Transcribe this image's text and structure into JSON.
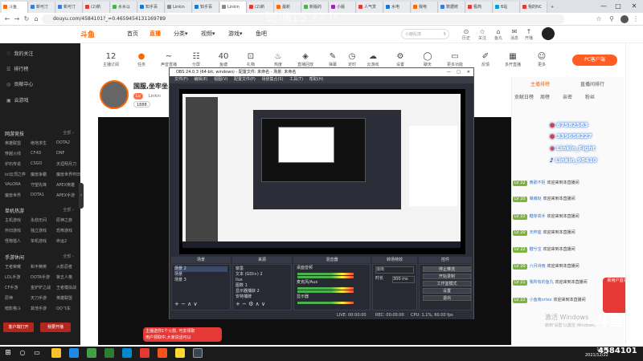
{
  "browser": {
    "tabs": [
      "斗鱼",
      "新可汀",
      "新可汀",
      "(2)新",
      "水水以",
      "知乎百",
      "Linkin",
      "知乎百",
      "Linkin",
      "(2)新",
      "最新",
      "新版的",
      "小版",
      "人气赏",
      "水电",
      "我电",
      "数据统",
      "极简",
      "B站",
      "我的NC",
      "+"
    ],
    "url": "douyu.com/4584101?_=0.4659454131169789",
    "win_controls": [
      "—",
      "□",
      "✕"
    ]
  },
  "header": {
    "logo": "斗鱼",
    "nav": [
      "首页",
      "直播",
      "分类▾",
      "视频▾",
      "游戏▾",
      "鱼吧"
    ],
    "search_placeholder": "小鹿乱撞",
    "icons": [
      {
        "icon": "⊙",
        "label": "历史"
      },
      {
        "icon": "☆",
        "label": "关注"
      },
      {
        "icon": "⌂",
        "label": "鱼丸"
      },
      {
        "icon": "✉",
        "label": "消息"
      },
      {
        "icon": "↑",
        "label": "开播"
      }
    ]
  },
  "sidebar": {
    "top": [
      {
        "icon": "♡",
        "label": "我的关注"
      },
      {
        "icon": "☰",
        "label": "排行榜"
      },
      {
        "icon": "◎",
        "label": "贡献中心"
      },
      {
        "icon": "▣",
        "label": "云游戏"
      }
    ],
    "sections": [
      {
        "title": "网游竞技",
        "more": "全部 ›",
        "cells": [
          "英雄联盟",
          "绝地求生",
          "DOTA2",
          "穿越火线",
          "CF4D",
          "DNF",
          "炉石传说",
          "CSGO",
          "天涯明月刀",
          "lol云顶之弈",
          "魔兽争霸",
          "魔兽世界怀旧",
          "VALORA",
          "守望先锋",
          "APEX英雄",
          "魔兽世界",
          "DOTA1",
          "APEX手游"
        ]
      },
      {
        "title": "单机热游",
        "more": "全部 ›",
        "cells": [
          "主机游戏",
          "永劫无间",
          "原神之旅",
          "怀旧游戏",
          "独立游戏",
          "恐怖游戏",
          "怪物猎人",
          "单机游戏",
          "命运2"
        ]
      },
      {
        "title": "手游休闲",
        "more": "全部 ›",
        "cells": [
          "王者荣耀",
          "和平精英",
          "火影忍者",
          "LOL手游",
          "DOTA手游",
          "第五人格",
          "CF手游",
          "金铲铲之战",
          "王者模拟战",
          "原神",
          "天刀手游",
          "英雄联盟",
          "暗影格斗",
          "其他手游",
          "QQ飞车"
        ]
      }
    ],
    "buttons": [
      "客户端打开",
      "我要开播"
    ]
  },
  "categories": [
    {
      "icon": "12",
      "label": "主播订阅"
    },
    {
      "icon": "●",
      "label": "任务"
    },
    {
      "icon": "~",
      "label": "声音直播"
    },
    {
      "icon": "☷",
      "label": "分屏"
    },
    {
      "icon": "40",
      "label": "鱼塘"
    },
    {
      "icon": "⊡",
      "label": "礼物"
    },
    {
      "icon": "♨",
      "label": "热度"
    },
    {
      "icon": "◈",
      "label": "直播回放"
    },
    {
      "icon": "✎",
      "label": "弹幕"
    },
    {
      "icon": "◷",
      "label": "定时"
    },
    {
      "icon": "☁",
      "label": "云游戏"
    },
    {
      "icon": "⚙",
      "label": "设置"
    },
    {
      "icon": "◯",
      "label": "聊天"
    },
    {
      "icon": "▭",
      "label": "更多功能"
    },
    {
      "icon": "✐",
      "label": "反馈"
    },
    {
      "icon": "▦",
      "label": "多开直播"
    },
    {
      "icon": "☺",
      "label": "更多"
    }
  ],
  "pc_button": "PC客户端",
  "room": {
    "title": "国服,坐牢坐...",
    "tags": [
      "Lv",
      "Linkin",
      "1888"
    ]
  },
  "watermark": "斑斓15 ?? ir",
  "obs": {
    "title": "OBS 24.0.3 (64-bit, windows) - 配置文件: 未命名 - 场景: 未命名",
    "menu": [
      "文件(F)",
      "编辑(E)",
      "视图(V)",
      "配置文件(P)",
      "场景集合(S)",
      "工具(T)",
      "帮助(H)"
    ],
    "docks": [
      "场景",
      "来源",
      "混音器",
      "转场特效",
      "控件"
    ],
    "scenes": [
      "场景 2",
      "场景",
      "场景 3"
    ],
    "sources": [
      "窗墨",
      "文本 (GDI+) 2",
      "ilus",
      "图数 1",
      "显示器捕获 2",
      "安特捕牌"
    ],
    "mixer": [
      "桌面音频",
      "麦克风/Aux",
      "显示器"
    ],
    "transition": [
      "淡出",
      "时长",
      "300 ms"
    ],
    "controls": [
      "停止推流",
      "开始录制",
      "工作室模式",
      "设置",
      "退出"
    ],
    "status": [
      "LIVE: 00:00:00",
      "REC: 00:00:00",
      "CPU: 1.1%, 60.00 fps"
    ]
  },
  "right_panel": {
    "tabs": [
      "主播排榜",
      "直播间排行",
      "贡献日榜",
      "周榜",
      "亲密",
      "粉丝"
    ],
    "qq_lines": [
      "67582583",
      "339658227",
      "Linkin_Fight",
      "Linkin_98410"
    ],
    "chats": [
      {
        "lv": "LV 22",
        "name": "黄鹂不拒",
        "msg": "欢迎来到本直播间"
      },
      {
        "lv": "LV 20",
        "name": "萌萌哒",
        "msg": "欢迎来到本直播间"
      },
      {
        "lv": "LV 22",
        "name": "糖芽高手",
        "msg": "欢迎来到本直播间"
      },
      {
        "lv": "LV 20",
        "name": "天秤座",
        "msg": "欢迎来到本直播间"
      },
      {
        "lv": "LV 22",
        "name": "糖兮宝",
        "msg": "欢迎来到本直播间"
      },
      {
        "lv": "LV 20",
        "name": "六月诗雨",
        "msg": "欢迎来到本直播间"
      },
      {
        "lv": "LV 21",
        "name": "我所有的鱼丸",
        "msg": "欢迎来到本直播间"
      },
      {
        "lv": "LV 22",
        "name": "小鱼南ortex",
        "msg": "欢迎来到本直播间"
      }
    ],
    "gift": "新用户首充"
  },
  "activate": {
    "line1": "激活 Windows",
    "line2": "转到'设置'以激活 Windows。"
  },
  "douyu_mark": "斗鱼",
  "room_number": "4584101",
  "toast": {
    "line1": "主播送你1个火箭, 可去领取",
    "line2": "用户领取中,大家说话可以"
  },
  "clock": {
    "time": "12:06",
    "date": "2021/12/22"
  }
}
